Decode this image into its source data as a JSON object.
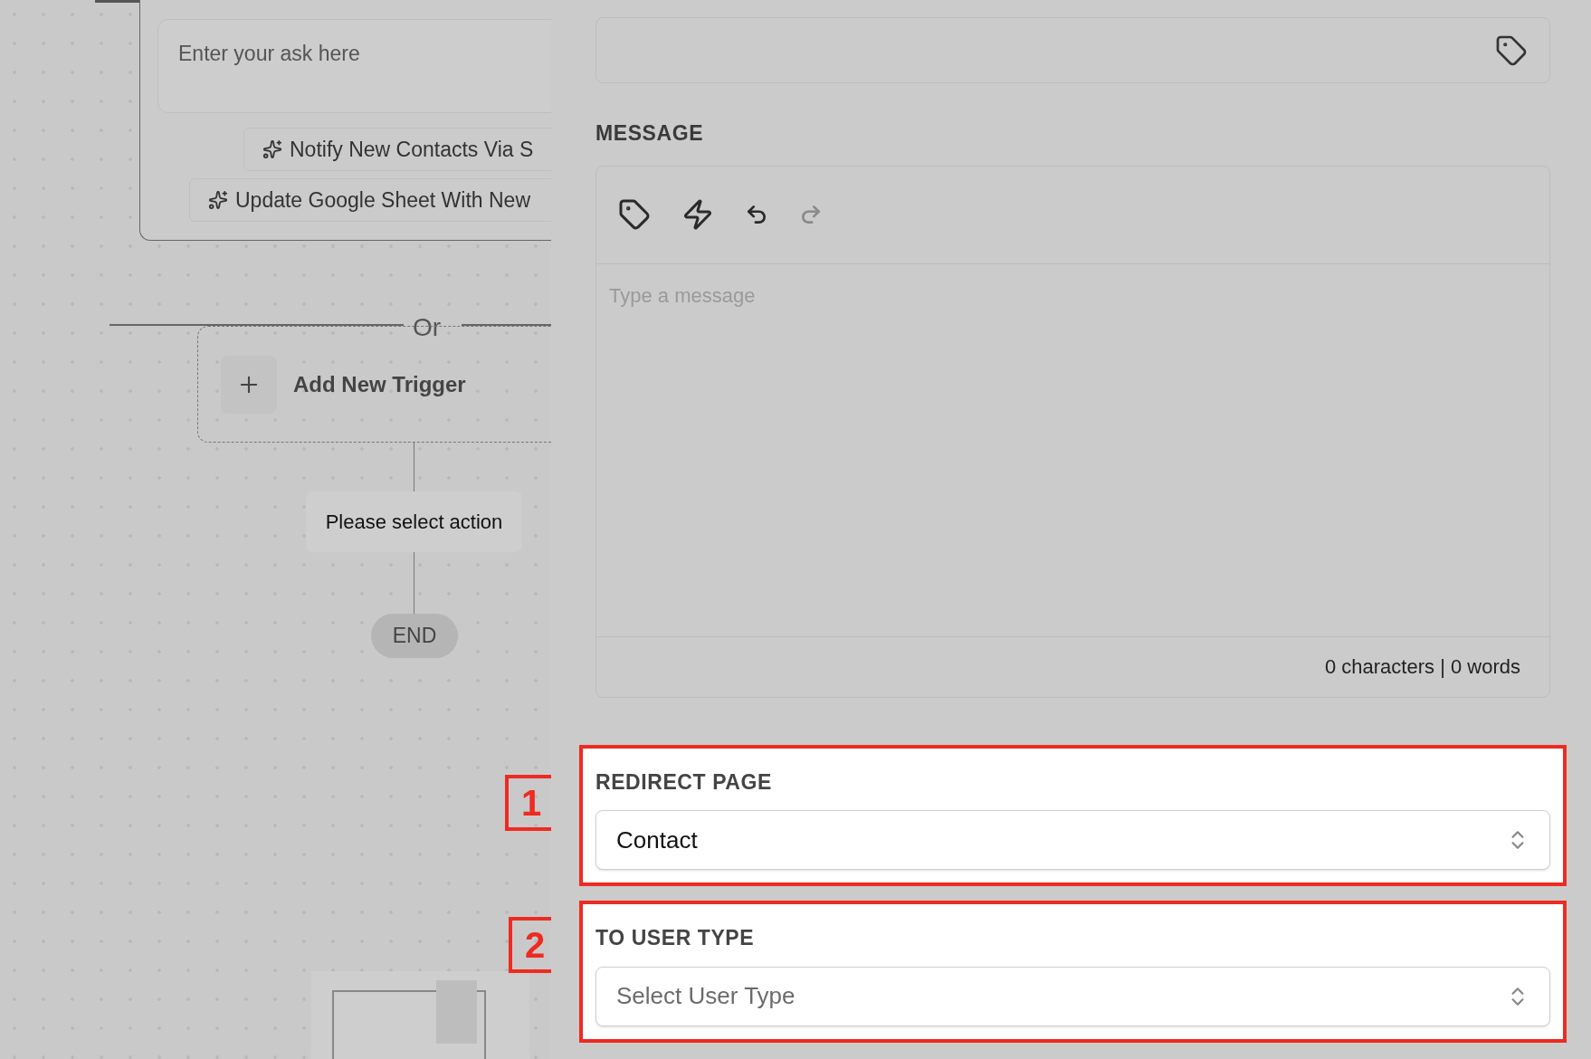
{
  "canvas": {
    "prompt_field": {
      "placeholder": "Enter your ask here"
    },
    "suggestions": [
      "Notify New Contacts Via S",
      "Update Google Sheet With New"
    ],
    "divider_label": "Or",
    "add_trigger": {
      "label": "Add New Trigger"
    },
    "action_node": {
      "label": "Please select action"
    },
    "end_node": {
      "label": "END"
    }
  },
  "panel": {
    "message": {
      "label": "MESSAGE",
      "toolbar": [
        {
          "kind": "tag",
          "disabled": false
        },
        {
          "kind": "bolt",
          "disabled": false
        },
        {
          "kind": "undo",
          "disabled": false
        },
        {
          "kind": "redo",
          "disabled": true
        }
      ],
      "placeholder": "Type a message",
      "counter": "0 characters | 0 words"
    },
    "fields": [
      {
        "label": "REDIRECT PAGE",
        "value": "Contact",
        "highlighted": true,
        "callout": "1"
      },
      {
        "label": "TO USER TYPE",
        "placeholder": "Select User Type",
        "highlighted": true,
        "callout": "2"
      }
    ]
  }
}
